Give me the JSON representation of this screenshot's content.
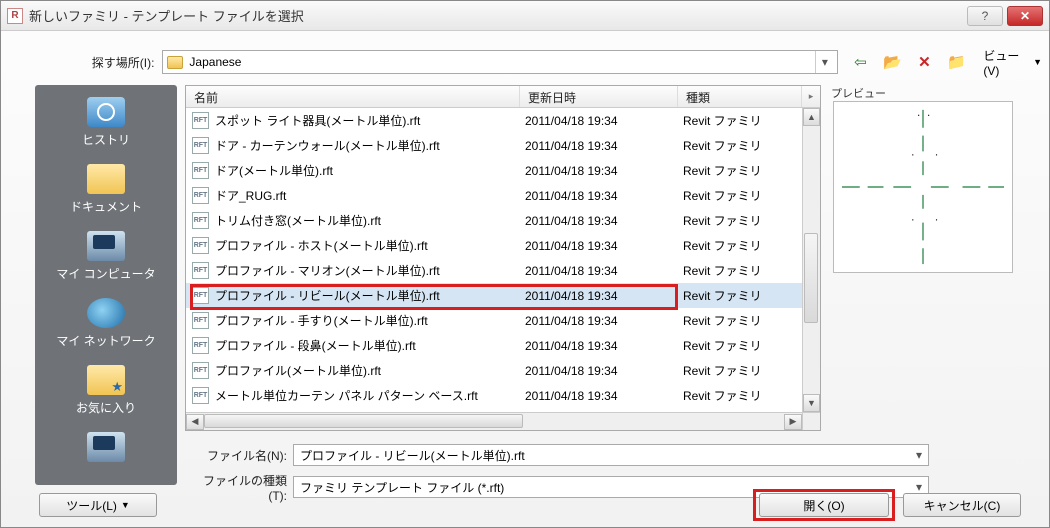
{
  "window": {
    "title": "新しいファミリ - テンプレート ファイルを選択"
  },
  "lookin": {
    "label": "探す場所(I):",
    "folder": "Japanese"
  },
  "toolbar": {
    "view_label": "ビュー(V)"
  },
  "sidebar": {
    "items": [
      {
        "label": "ヒストリ"
      },
      {
        "label": "ドキュメント"
      },
      {
        "label": "マイ コンピュータ"
      },
      {
        "label": "マイ ネットワーク"
      },
      {
        "label": "お気に入り"
      }
    ]
  },
  "columns": {
    "name": "名前",
    "date": "更新日時",
    "type": "種類"
  },
  "files": [
    {
      "name": "スポット ライト器具(メートル単位).rft",
      "date": "2011/04/18 19:34",
      "type": "Revit ファミリ"
    },
    {
      "name": "ドア - カーテンウォール(メートル単位).rft",
      "date": "2011/04/18 19:34",
      "type": "Revit ファミリ"
    },
    {
      "name": "ドア(メートル単位).rft",
      "date": "2011/04/18 19:34",
      "type": "Revit ファミリ"
    },
    {
      "name": "ドア_RUG.rft",
      "date": "2011/04/18 19:34",
      "type": "Revit ファミリ"
    },
    {
      "name": "トリム付き窓(メートル単位).rft",
      "date": "2011/04/18 19:34",
      "type": "Revit ファミリ"
    },
    {
      "name": "プロファイル - ホスト(メートル単位).rft",
      "date": "2011/04/18 19:34",
      "type": "Revit ファミリ"
    },
    {
      "name": "プロファイル - マリオン(メートル単位).rft",
      "date": "2011/04/18 19:34",
      "type": "Revit ファミリ"
    },
    {
      "name": "プロファイル - リビール(メートル単位).rft",
      "date": "2011/04/18 19:34",
      "type": "Revit ファミリ",
      "selected": true
    },
    {
      "name": "プロファイル - 手すり(メートル単位).rft",
      "date": "2011/04/18 19:34",
      "type": "Revit ファミリ"
    },
    {
      "name": "プロファイル - 段鼻(メートル単位).rft",
      "date": "2011/04/18 19:34",
      "type": "Revit ファミリ"
    },
    {
      "name": "プロファイル(メートル単位).rft",
      "date": "2011/04/18 19:34",
      "type": "Revit ファミリ"
    },
    {
      "name": "メートル単位カーテン パネル パターン ベース.rft",
      "date": "2011/04/18 19:34",
      "type": "Revit ファミリ"
    }
  ],
  "fields": {
    "filename_label": "ファイル名(N):",
    "filename_value": "プロファイル - リビール(メートル単位).rft",
    "filetype_label": "ファイルの種類(T):",
    "filetype_value": "ファミリ テンプレート ファイル (*.rft)"
  },
  "buttons": {
    "tool": "ツール(L)",
    "open": "開く(O)",
    "cancel": "キャンセル(C)"
  },
  "preview": {
    "label": "プレビュー"
  }
}
